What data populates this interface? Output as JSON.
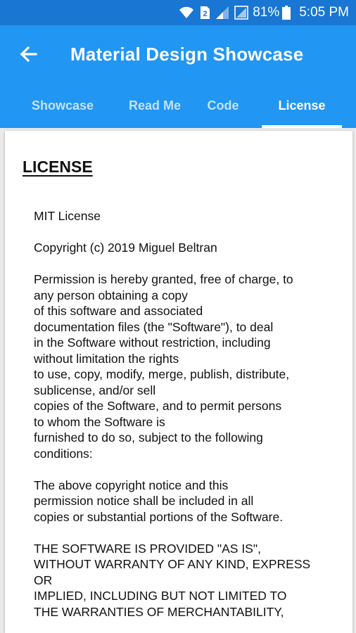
{
  "status_bar": {
    "battery": "81%",
    "time": "5:05 PM",
    "sim": "2",
    "icons": [
      "wifi-icon",
      "sim-icon",
      "signal-icon",
      "signal-icon",
      "battery-icon"
    ]
  },
  "toolbar": {
    "title": "Material Design Showcase",
    "back_icon": "back-arrow-icon"
  },
  "tabs": [
    {
      "label": "Showcase"
    },
    {
      "label": "Read Me"
    },
    {
      "label": "Code"
    },
    {
      "label": "License"
    }
  ],
  "content": {
    "heading": "LICENSE",
    "paragraphs": [
      "MIT License",
      "Copyright (c) 2019 Miguel Beltran",
      "Permission is hereby granted, free of charge, to\nany person obtaining a copy\nof this software and associated\ndocumentation files (the \"Software\"), to deal\nin the Software without restriction, including\nwithout limitation the rights\nto use, copy, modify, merge, publish, distribute,\nsublicense, and/or sell\ncopies of the Software, and to permit persons\nto whom the Software is\nfurnished to do so, subject to the following\nconditions:",
      "The above copyright notice and this\npermission notice shall be included in all\ncopies or substantial portions of the Software.",
      "THE SOFTWARE IS PROVIDED \"AS IS\",\nWITHOUT WARRANTY OF ANY KIND, EXPRESS\nOR\nIMPLIED, INCLUDING BUT NOT LIMITED TO\nTHE WARRANTIES OF MERCHANTABILITY,"
    ]
  },
  "colors": {
    "status_bar": "#1976d2",
    "app_bar": "#2196f3",
    "card": "#ffffff",
    "background": "#e9e9e9"
  }
}
